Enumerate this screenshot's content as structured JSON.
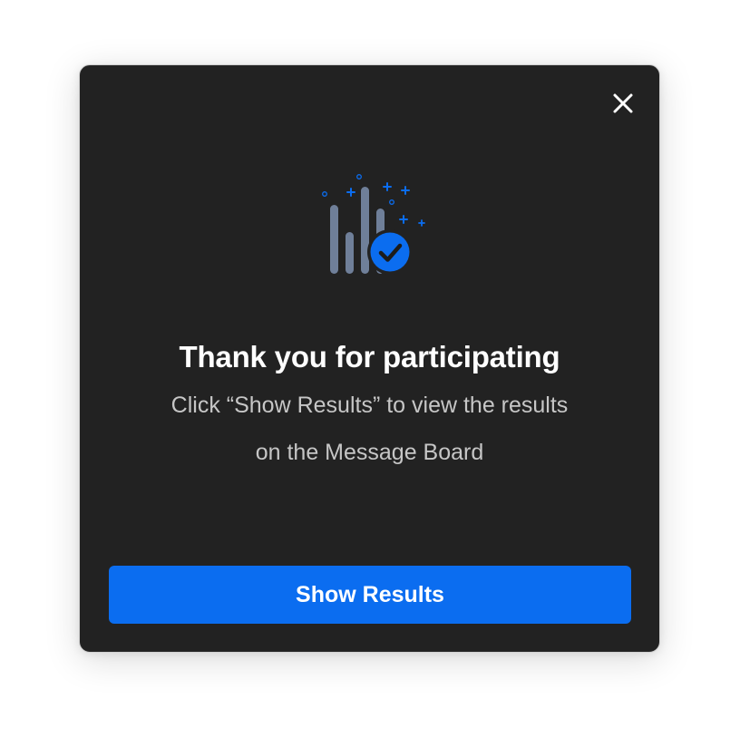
{
  "dialog": {
    "close_icon": "close-icon",
    "illustration_icon": "poll-results-check-icon",
    "title": "Thank you for participating",
    "message": "Click “Show Results” to view the  results\non the Message Board",
    "primary_button_label": "Show Results"
  },
  "colors": {
    "modal_background": "#222222",
    "accent": "#0b6df0",
    "bar_gray": "#6f7f99",
    "title_text": "#ffffff",
    "body_text": "#c6c6c6"
  }
}
